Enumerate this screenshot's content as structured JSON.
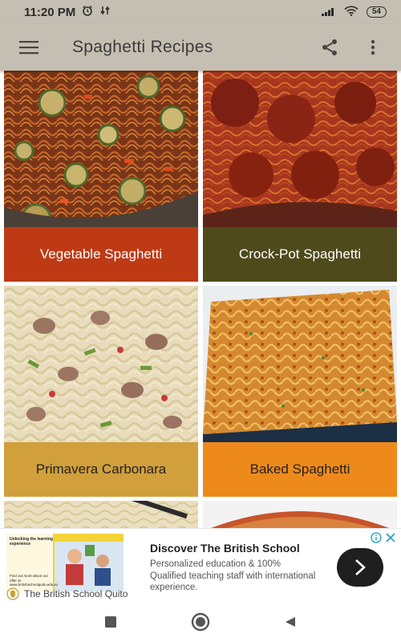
{
  "status": {
    "time": "11:20 PM",
    "battery": "54"
  },
  "app_bar": {
    "title": "Spaghetti Recipes"
  },
  "recipes": [
    {
      "name": "Vegetable Spaghetti",
      "label_color": "#be3a14"
    },
    {
      "name": "Crock-Pot Spaghetti",
      "label_color": "#4f4a1c"
    },
    {
      "name": "Primavera Carbonara",
      "label_color": "#d1a03c"
    },
    {
      "name": "Baked Spaghetti",
      "label_color": "#ee8a1c"
    },
    {
      "name": "",
      "label_color": "#c9c9c9"
    },
    {
      "name": "",
      "label_color": "#c9c9c9"
    }
  ],
  "ad": {
    "title": "Discover The British School",
    "body": "Personalized education & 100% Qualified teaching staff with international experience.",
    "source": "The British School Quito",
    "image_caption_top": "Unlocking the learning experience",
    "image_caption_bottom": "Find out more about our offer at www.britishschoolquito.edu.ec"
  },
  "colors": {
    "app_bar": "#c4bfb2",
    "ad_cta": "#1f1f1f"
  }
}
